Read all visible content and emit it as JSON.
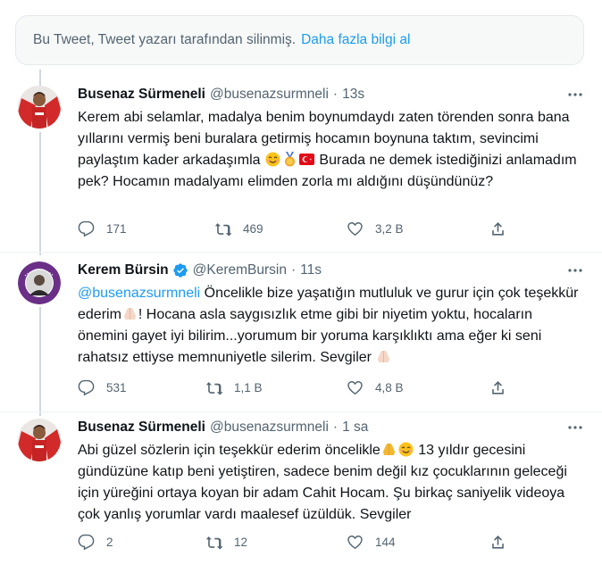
{
  "notice": {
    "text": "Bu Tweet, Tweet yazarı tarafından silinmiş.",
    "link": "Daha fazla bilgi al"
  },
  "tweets": [
    {
      "name": "Busenaz Sürmeneli",
      "handle": "@busenazsurmneli",
      "time": "13s",
      "text_before": "Kerem abi selamlar, madalya benim boynumdaydı zaten törenden sonra bana yıllarını vermiş beni buralara getirmiş hocamın boynuna taktım, sevincimi paylaştım kader arkadaşımla ",
      "text_after": " Burada ne demek istediğinizi anlamadım pek? Hocamın madalyamı elimden zorla mı aldığını düşündünüz?",
      "replies": "171",
      "retweets": "469",
      "likes": "3,2 B"
    },
    {
      "name": "Kerem Bürsin",
      "handle": "@KeremBursin",
      "time": "11s",
      "mention": "@busenazsurmneli",
      "text_1": " Öncelikle bize yaşatığın mutluluk ve gurur için çok teşekkür ederim",
      "text_2": "! Hocana asla saygısızlık etme gibi bir niyetim yoktu, hocaların önemini gayet iyi bilirim...yorumum bir yoruma karşıklıktı ama eğer ki seni rahatsız ettiyse memnuniyetle silerim. Sevgiler ",
      "replies": "531",
      "retweets": "1,1 B",
      "likes": "4,8 B"
    },
    {
      "name": "Busenaz Sürmeneli",
      "handle": "@busenazsurmneli",
      "time": "1 sa",
      "text_1": "Abi güzel sözlerin için teşekkür ederim öncelikle",
      "text_2": " 13 yıldır gecesini gündüzüne katıp beni yetiştiren, sadece benim değil kız çocuklarının geleceği için yüreğini ortaya koyan bir adam Cahit Hocam. Şu birkaç saniyelik videoya çok yanlış yorumlar vardı maalesef üzüldük. Sevgiler",
      "replies": "2",
      "retweets": "12",
      "likes": "144"
    }
  ],
  "icons": {
    "reply": "reply-icon",
    "retweet": "retweet-icon",
    "like": "heart-icon",
    "share": "share-icon",
    "more": "more-icon",
    "verified": "verified-badge-icon",
    "emojis": [
      "smiling-face-emoji",
      "medal-emoji",
      "turkey-flag-emoji",
      "folded-hands-emoji"
    ]
  },
  "colors": {
    "accent": "#1d9bf0",
    "secondary_text": "#536471",
    "verified": "#1d9bf0"
  }
}
